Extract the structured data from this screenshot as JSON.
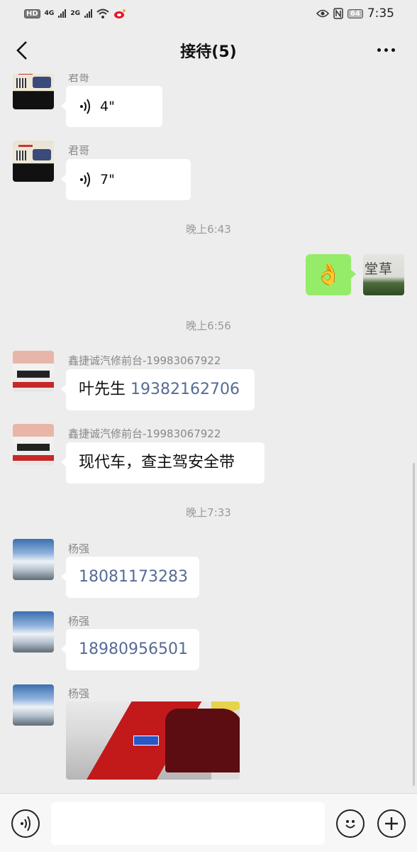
{
  "status_bar": {
    "hd_label": "HD",
    "sim1_label": "4G",
    "sim2_label": "2G",
    "battery": "64",
    "time": "7:35"
  },
  "header": {
    "title": "接待(5)",
    "back_icon": "chevron-left-icon",
    "more_icon": "more-dots-icon"
  },
  "messages": [
    {
      "sender": "君哥",
      "voice_length": "4\""
    },
    {
      "sender": "君哥",
      "voice_length": "7\""
    },
    {
      "time": "晚上6:43"
    },
    {
      "emoji": "👌"
    },
    {
      "time": "晚上6:56"
    },
    {
      "sender": "鑫捷诚汽修前台-19983067922",
      "prefix": "叶先生 ",
      "link": "19382162706"
    },
    {
      "sender": "鑫捷诚汽修前台-19983067922",
      "text": "现代车，查主驾安全带"
    },
    {
      "time": "晚上7:33"
    },
    {
      "sender": "杨强",
      "link": "18081173283"
    },
    {
      "sender": "杨强",
      "link": "18980956501"
    },
    {
      "sender": "杨强",
      "image": "car-photo"
    }
  ],
  "my_avatar_text": "堂草",
  "bottom_bar": {
    "voice_icon": "voice-icon",
    "emoji_icon": "smiley-icon",
    "plus_icon": "plus-icon",
    "input_value": ""
  },
  "colors": {
    "background": "#ededed",
    "my_bubble": "#95ec69",
    "link": "#576b95"
  }
}
